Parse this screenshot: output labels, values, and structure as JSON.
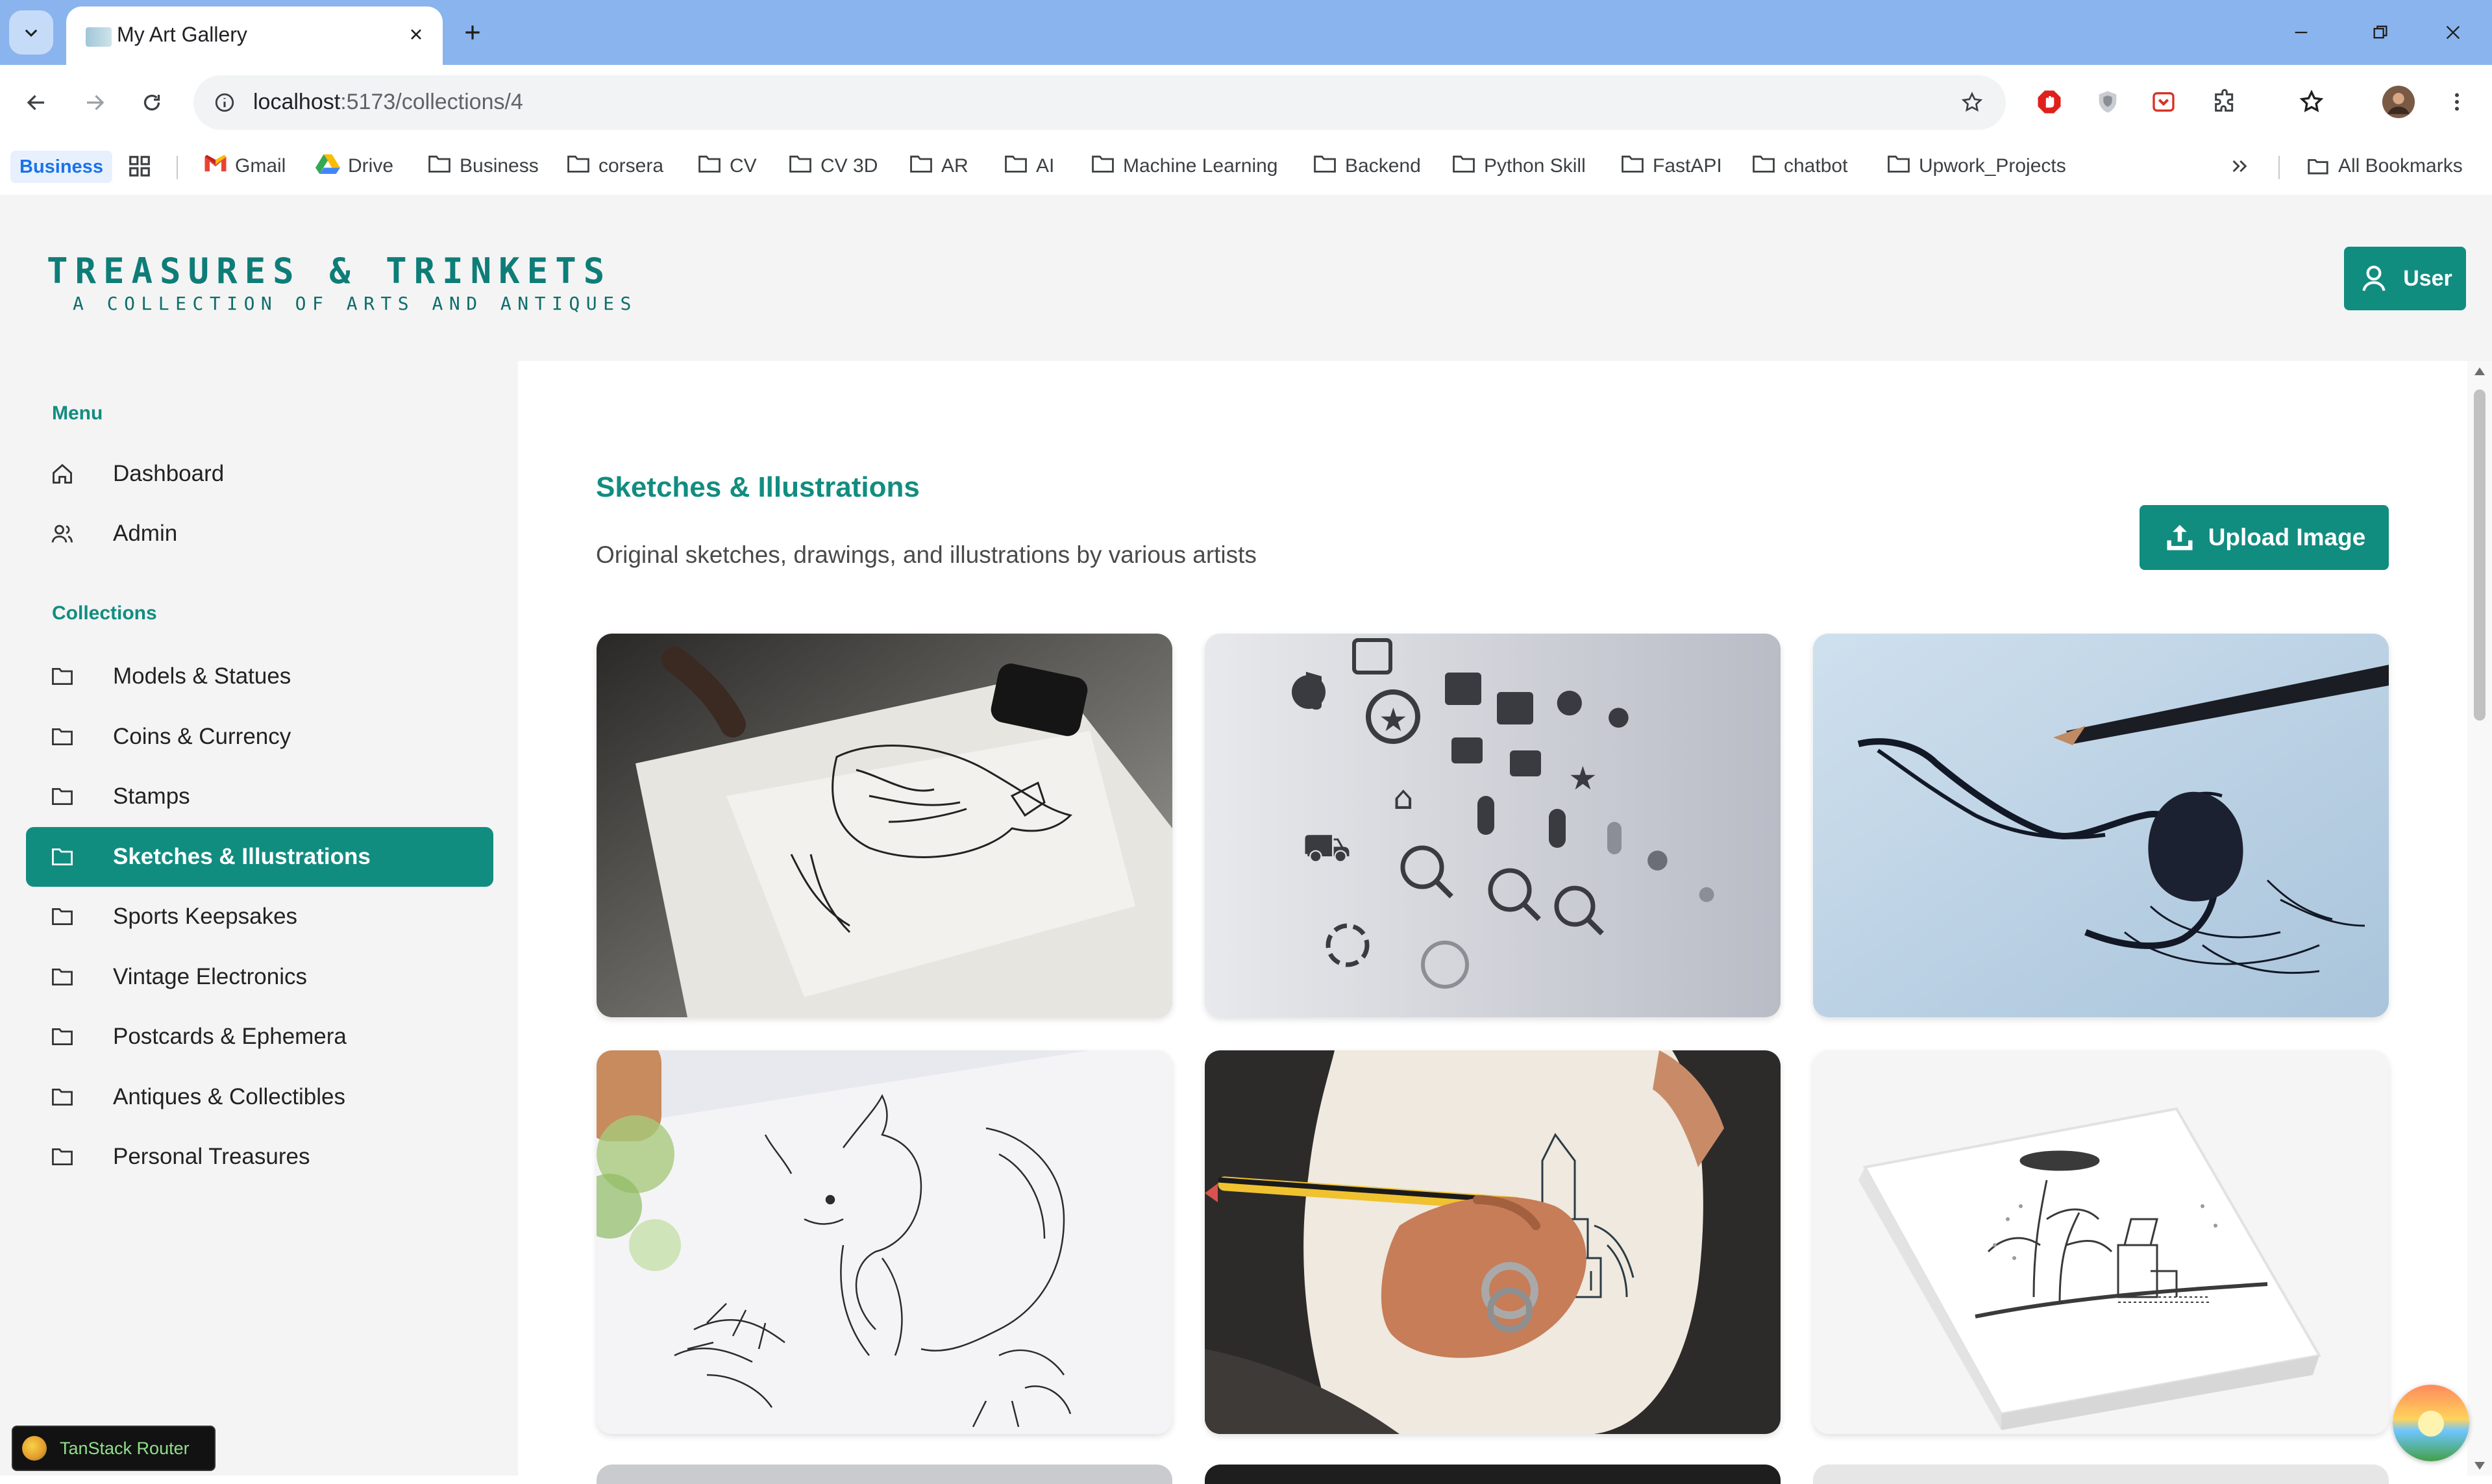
{
  "browser": {
    "tab_title": "My Art Gallery",
    "url_host": "localhost",
    "url_path": ":5173/collections/4",
    "bookmarks": [
      {
        "label": "Gmail",
        "icon": "gmail-icon"
      },
      {
        "label": "Drive",
        "icon": "drive-icon"
      },
      {
        "label": "Business",
        "icon": "folder-icon"
      },
      {
        "label": "corsera",
        "icon": "folder-icon"
      },
      {
        "label": "CV",
        "icon": "folder-icon"
      },
      {
        "label": "CV 3D",
        "icon": "folder-icon"
      },
      {
        "label": "AR",
        "icon": "folder-icon"
      },
      {
        "label": "AI",
        "icon": "folder-icon"
      },
      {
        "label": "Machine Learning",
        "icon": "folder-icon"
      },
      {
        "label": "Backend",
        "icon": "folder-icon"
      },
      {
        "label": "Python Skill",
        "icon": "folder-icon"
      },
      {
        "label": "FastAPI",
        "icon": "folder-icon"
      },
      {
        "label": "chatbot",
        "icon": "folder-icon"
      },
      {
        "label": "Upwork_Projects",
        "icon": "folder-icon"
      }
    ],
    "bookmark_profile_chip": "Business",
    "all_bookmarks": "All Bookmarks",
    "colors": {
      "tabstrip": "#8ab4ee",
      "accent": "#1a73e8"
    }
  },
  "header": {
    "logo_title": "TREASURES & TRINKETS",
    "logo_subtitle": "A COLLECTION OF ARTS AND ANTIQUES",
    "user_button": "User"
  },
  "sidebar": {
    "menu_title": "Menu",
    "menu_items": [
      {
        "label": "Dashboard",
        "icon": "home-icon"
      },
      {
        "label": "Admin",
        "icon": "users-icon"
      }
    ],
    "collections_title": "Collections",
    "collections": [
      {
        "label": "Models & Statues",
        "active": false
      },
      {
        "label": "Coins & Currency",
        "active": false
      },
      {
        "label": "Stamps",
        "active": false
      },
      {
        "label": "Sketches & Illustrations",
        "active": true
      },
      {
        "label": "Sports Keepsakes",
        "active": false
      },
      {
        "label": "Vintage Electronics",
        "active": false
      },
      {
        "label": "Postcards & Ephemera",
        "active": false
      },
      {
        "label": "Antiques & Collectibles",
        "active": false
      },
      {
        "label": "Personal Treasures",
        "active": false
      }
    ]
  },
  "main": {
    "title": "Sketches & Illustrations",
    "description": "Original sketches, drawings, and illustrations by various artists",
    "upload_button": "Upload Image",
    "gallery": [
      {
        "subject": "wolf sketch on paper"
      },
      {
        "subject": "icon sketches on paper"
      },
      {
        "subject": "ink figure with pencil"
      },
      {
        "subject": "squirrel line drawing"
      },
      {
        "subject": "hand drawing building in sketchbook"
      },
      {
        "subject": "illustrated white book"
      }
    ]
  },
  "devtools": {
    "tanstack_label": "TanStack Router"
  },
  "theme": {
    "primary": "#118d80",
    "sidebar_bg": "#f4f4f4"
  }
}
